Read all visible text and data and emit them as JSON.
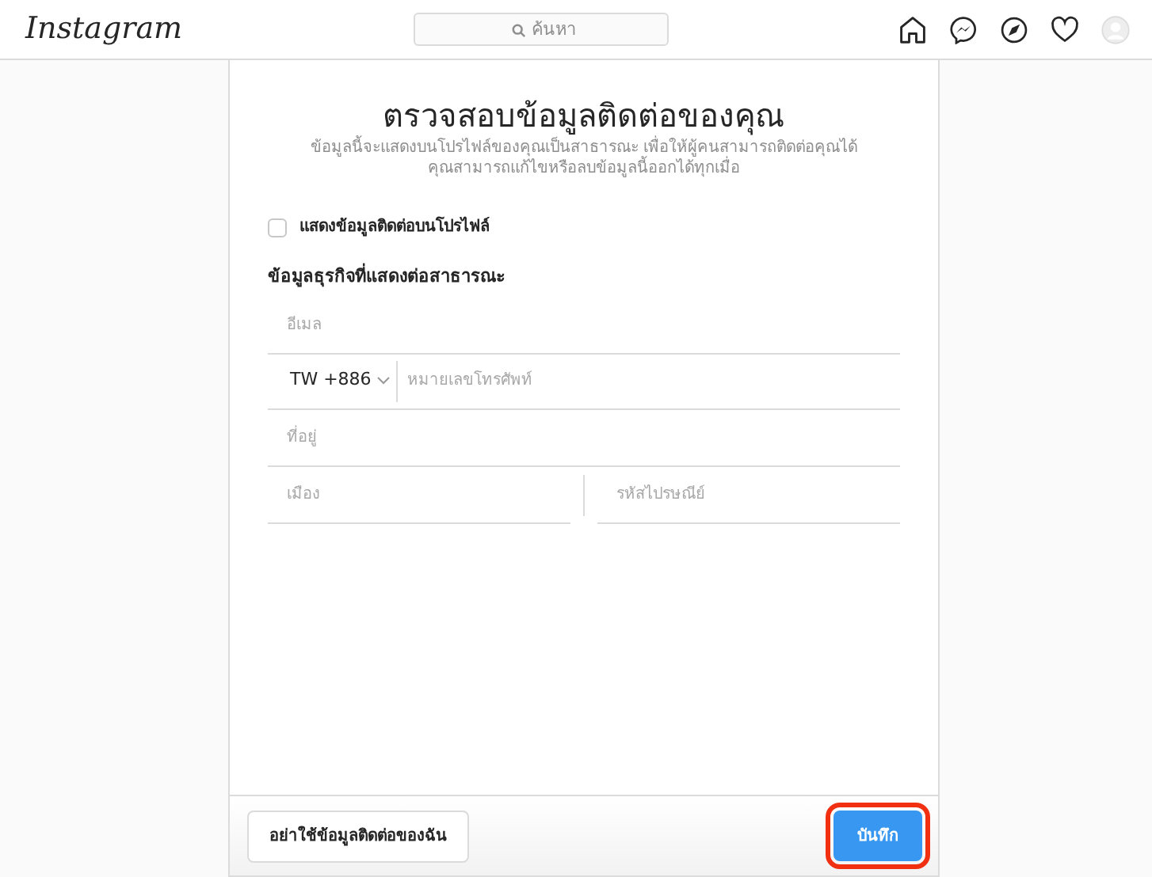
{
  "header": {
    "logo": "Instagram",
    "search": {
      "placeholder": "ค้นหา"
    }
  },
  "form": {
    "title": "ตรวจสอบข้อมูลติดต่อของคุณ",
    "subtitle": "ข้อมูลนี้จะแสดงบนโปรไฟล์ของคุณเป็นสาธารณะ เพื่อให้ผู้คนสามารถติดต่อคุณได้ คุณสามารถแก้ไขหรือลบข้อมูลนี้ออกได้ทุกเมื่อ",
    "show_on_profile": {
      "label": "แสดงข้อมูลติดต่อบนโปรไฟล์",
      "checked": false
    },
    "section": "ข้อมูลธุรกิจที่แสดงต่อสาธารณะ",
    "email": {
      "placeholder": "อีเมล"
    },
    "phone": {
      "country_code": "TW +886",
      "placeholder": "หมายเลขโทรศัพท์"
    },
    "address": {
      "placeholder": "ที่อยู่"
    },
    "city": {
      "placeholder": "เมือง"
    },
    "postcode": {
      "placeholder": "รหัสไปรษณีย์"
    }
  },
  "footer": {
    "skip_button": "อย่าใช้ข้อมูลติดต่อของฉัน",
    "save_button": {
      "label": "บันทึก",
      "highlighted": true
    }
  }
}
